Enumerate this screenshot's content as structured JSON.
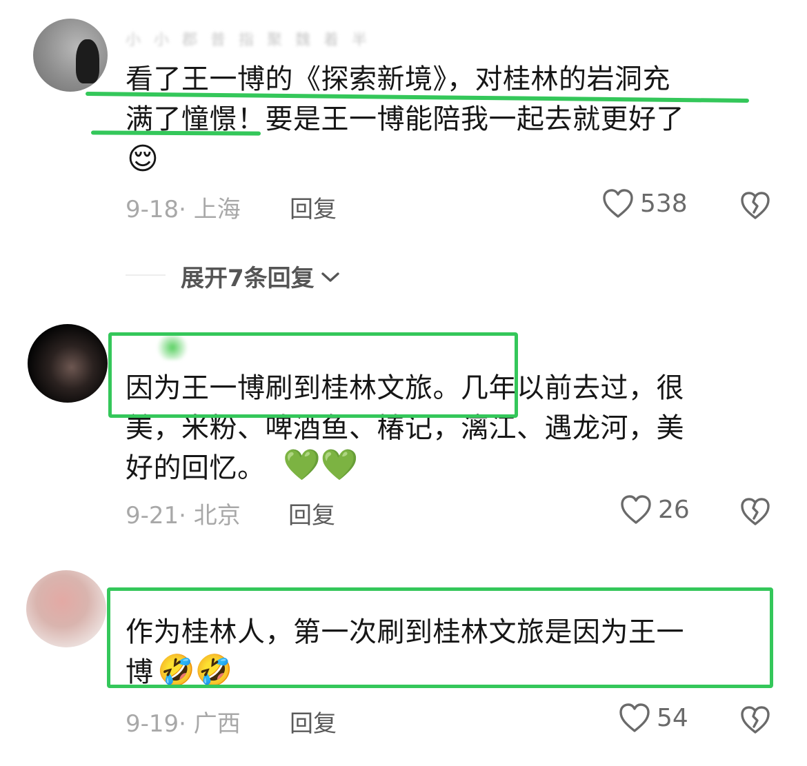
{
  "accent_color": "#34c75a",
  "comments": [
    {
      "username": "小 小 郡 普 指 聚 魏 着 半",
      "text": "看了王一博的《探索新境》，对桂林的岩洞充\n满了憧憬！要是王一博能陪我一起去就更好了",
      "emoji": "😌",
      "date": "9-18",
      "location": "上海",
      "reply_label": "回复",
      "likes": "538",
      "expand_label": "展开7条回复"
    },
    {
      "text": "因为王一博刷到桂林文旅。几年以前去过，很\n美，米粉、啤酒鱼、椿记，漓江、遇龙河，美\n好的回忆。",
      "emoji": "💚💚",
      "date": "9-21",
      "location": "北京",
      "reply_label": "回复",
      "likes": "26"
    },
    {
      "text": "作为桂林人，第一次刷到桂林文旅是因为王一\n博",
      "emoji": "🤣🤣",
      "date": "9-19",
      "location": "广西",
      "reply_label": "回复",
      "likes": "54"
    }
  ],
  "icons": {
    "like": "heart-outline-icon",
    "dislike": "broken-heart-icon",
    "expand": "chevron-down-icon"
  }
}
